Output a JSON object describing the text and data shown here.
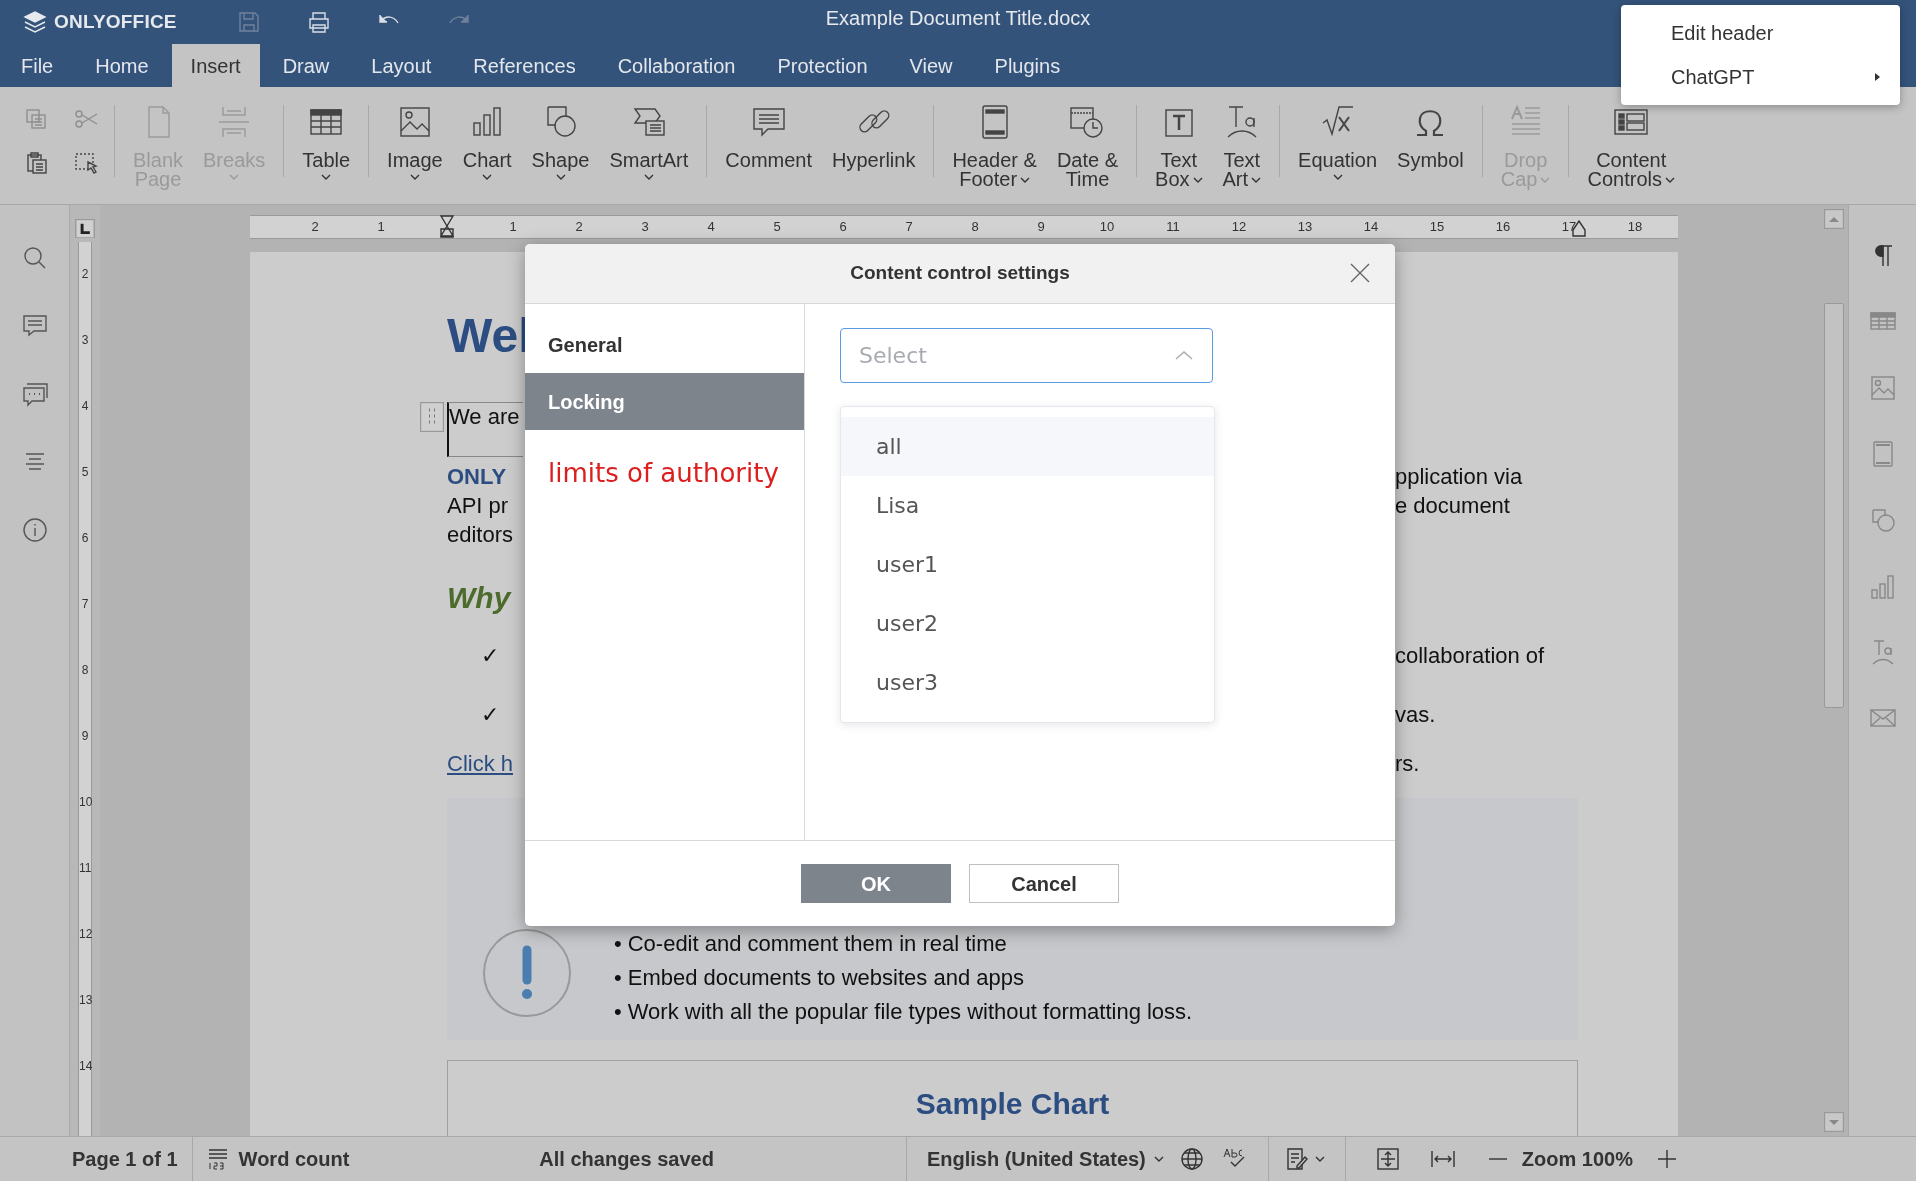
{
  "app": {
    "logo": "ONLYOFFICE",
    "title": "Example Document Title.docx"
  },
  "quick_access": [
    {
      "kind": "save",
      "disabled": true
    },
    {
      "kind": "print",
      "disabled": false
    },
    {
      "kind": "undo",
      "disabled": false
    },
    {
      "kind": "redo",
      "disabled": true
    }
  ],
  "tabs": [
    {
      "label": "File",
      "selected": false
    },
    {
      "label": "Home",
      "selected": false
    },
    {
      "label": "Insert",
      "selected": true
    },
    {
      "label": "Draw",
      "selected": false
    },
    {
      "label": "Layout",
      "selected": false
    },
    {
      "label": "References",
      "selected": false
    },
    {
      "label": "Collaboration",
      "selected": false
    },
    {
      "label": "Protection",
      "selected": false
    },
    {
      "label": "View",
      "selected": false
    },
    {
      "label": "Plugins",
      "selected": false
    }
  ],
  "context_menu": [
    {
      "label": "Edit header",
      "submenu": false
    },
    {
      "label": "ChatGPT",
      "submenu": true
    }
  ],
  "toolbar": {
    "clipboard": [
      {
        "kind": "copy",
        "disabled": true
      },
      {
        "kind": "cut",
        "disabled": true
      },
      {
        "kind": "paste",
        "disabled": false
      },
      {
        "kind": "select",
        "disabled": false
      }
    ],
    "groups": [
      [
        {
          "kind": "blank_page",
          "lines": [
            "Blank",
            "Page"
          ],
          "disabled": true,
          "dropdown": false
        },
        {
          "kind": "breaks",
          "lines": [
            "Breaks"
          ],
          "disabled": true,
          "dropdown": true
        }
      ],
      [
        {
          "kind": "table",
          "lines": [
            "Table"
          ],
          "disabled": false,
          "dropdown": true
        }
      ],
      [
        {
          "kind": "image",
          "lines": [
            "Image"
          ],
          "disabled": false,
          "dropdown": true
        },
        {
          "kind": "chart",
          "lines": [
            "Chart"
          ],
          "disabled": false,
          "dropdown": true
        },
        {
          "kind": "shape",
          "lines": [
            "Shape"
          ],
          "disabled": false,
          "dropdown": true
        },
        {
          "kind": "smartart",
          "lines": [
            "SmartArt"
          ],
          "disabled": false,
          "dropdown": true
        }
      ],
      [
        {
          "kind": "comment",
          "lines": [
            "Comment"
          ],
          "disabled": false,
          "dropdown": false
        },
        {
          "kind": "hyperlink",
          "lines": [
            "Hyperlink"
          ],
          "disabled": false,
          "dropdown": false
        }
      ],
      [
        {
          "kind": "header_footer",
          "lines": [
            "Header &",
            "Footer"
          ],
          "disabled": false,
          "dropdown": true
        },
        {
          "kind": "date_time",
          "lines": [
            "Date &",
            "Time"
          ],
          "disabled": false,
          "dropdown": false
        }
      ],
      [
        {
          "kind": "text_box",
          "lines": [
            "Text",
            "Box"
          ],
          "disabled": false,
          "dropdown": true
        },
        {
          "kind": "text_art",
          "lines": [
            "Text",
            "Art"
          ],
          "disabled": false,
          "dropdown": true
        }
      ],
      [
        {
          "kind": "equation",
          "lines": [
            "Equation"
          ],
          "disabled": false,
          "dropdown": true
        },
        {
          "kind": "symbol",
          "lines": [
            "Symbol"
          ],
          "disabled": false,
          "dropdown": false
        }
      ],
      [
        {
          "kind": "drop_cap",
          "lines": [
            "Drop",
            "Cap"
          ],
          "disabled": true,
          "dropdown": true
        }
      ],
      [
        {
          "kind": "content_controls",
          "lines": [
            "Content",
            "Controls"
          ],
          "disabled": false,
          "dropdown": true
        }
      ]
    ]
  },
  "rulers": {
    "horizontal": [
      "2",
      "1",
      "1",
      "2",
      "3",
      "4",
      "5",
      "6",
      "7",
      "8",
      "9",
      "10",
      "11",
      "12",
      "13",
      "14",
      "15",
      "16",
      "17",
      "18"
    ],
    "vertical": [
      "2",
      "3",
      "4",
      "5",
      "6",
      "7",
      "8",
      "9",
      "10",
      "11",
      "12",
      "13",
      "14"
    ]
  },
  "document": {
    "rows": [
      {
        "kind": "title",
        "left": "Wel"
      },
      {
        "kind": "control",
        "left": "We are"
      },
      {
        "kind": "brand",
        "left": "ONLY",
        "right": "pplication via"
      },
      {
        "kind": "text",
        "left": "API pr",
        "right": "e document"
      },
      {
        "kind": "text",
        "left": "editors"
      },
      {
        "kind": "heading",
        "left": "Why"
      },
      {
        "kind": "check",
        "left": "✓",
        "right": "collaboration of"
      },
      {
        "kind": "check",
        "left": "✓",
        "right": "vas."
      },
      {
        "kind": "link",
        "left": "Click h",
        "right": "rs."
      }
    ],
    "info_box": {
      "bullets": [
        {
          "marker": "•",
          "text": "Co-edit and comment them in real time"
        },
        {
          "marker": "•",
          "text": "Embed documents to websites and apps"
        },
        {
          "marker": "•",
          "text": "Work with all the popular file types without formatting loss."
        }
      ]
    },
    "chart_box": {
      "title": "Sample Chart"
    }
  },
  "dialog": {
    "title": "Content control settings",
    "nav": [
      {
        "label": "General",
        "selected": false
      },
      {
        "label": "Locking",
        "selected": true
      }
    ],
    "note": "limits of authority",
    "select": {
      "placeholder": "Select",
      "expanded": true
    },
    "options": [
      {
        "label": "all",
        "highlighted": true
      },
      {
        "label": "Lisa",
        "highlighted": false
      },
      {
        "label": "user1",
        "highlighted": false
      },
      {
        "label": "user2",
        "highlighted": false
      },
      {
        "label": "user3",
        "highlighted": false
      }
    ],
    "buttons": [
      {
        "label": "OK",
        "kind": "primary"
      },
      {
        "label": "Cancel",
        "kind": "secondary"
      }
    ]
  },
  "status_bar": {
    "page": "Page 1 of 1",
    "word_count": "Word count",
    "save_status": "All changes saved",
    "language": "English (United States)",
    "zoom": "Zoom 100%"
  }
}
